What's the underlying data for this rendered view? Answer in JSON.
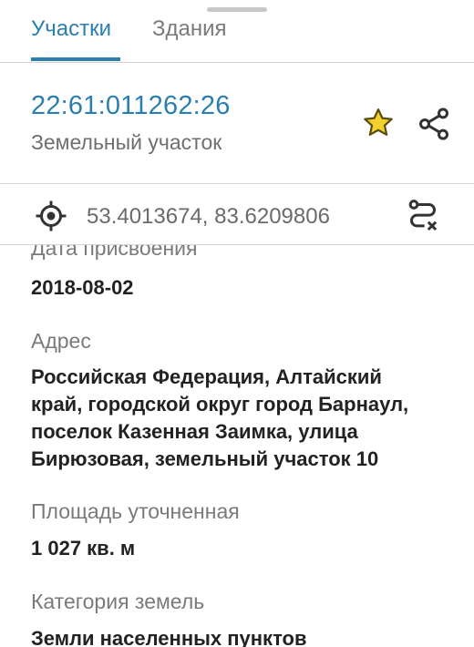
{
  "tabs": {
    "items": [
      {
        "label": "Участки",
        "active": true
      },
      {
        "label": "Здания",
        "active": false
      }
    ]
  },
  "parcel": {
    "cadastral_number": "22:61:011262:26",
    "type": "Земельный участок"
  },
  "location": {
    "coordinates": "53.4013674, 83.6209806"
  },
  "details": {
    "assignment_date_label": "Дата присвоения",
    "assignment_date": "2018-08-02",
    "address_label": "Адрес",
    "address_lines": [
      "Российская Федерация, Алтайский",
      "край, городской округ город Барнаул,",
      "поселок Казенная Заимка, улица",
      "Бирюзовая, земельный участок 10"
    ],
    "area_label": "Площадь уточненная",
    "area": "1 027 кв. м",
    "category_label": "Категория земель",
    "category": "Земли населенных пунктов"
  },
  "colors": {
    "accent": "#2a7fb0",
    "star": "#f2d12e",
    "text": "#222222",
    "muted": "#7a7a7a"
  },
  "icons": [
    "star-icon",
    "share-icon",
    "crosshair-icon",
    "route-clear-icon"
  ]
}
